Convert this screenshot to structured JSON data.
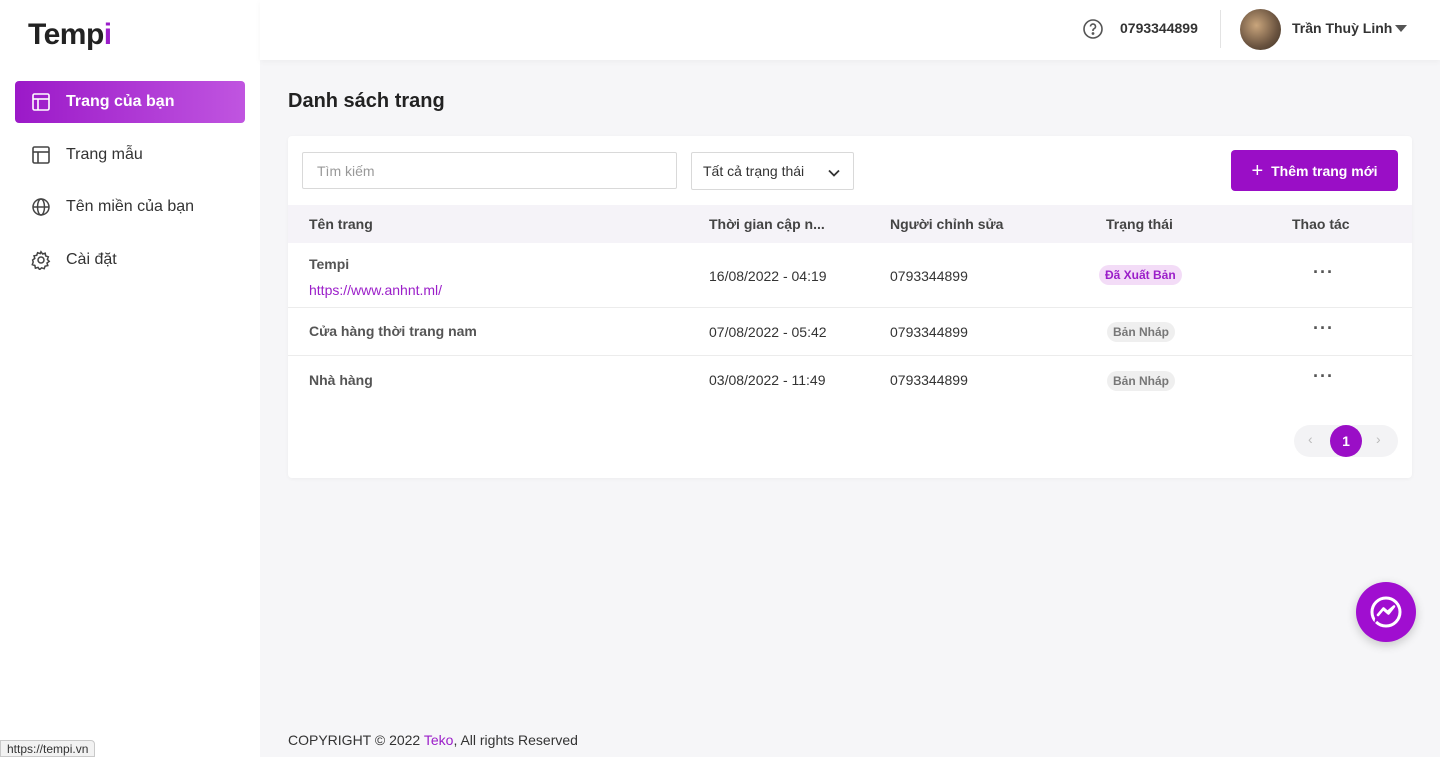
{
  "app": {
    "logo_main": "Temp",
    "logo_accent": "i"
  },
  "sidebar": {
    "items": [
      {
        "label": "Trang của bạn",
        "icon": "layout-icon",
        "active": true
      },
      {
        "label": "Trang mẫu",
        "icon": "layout-icon"
      },
      {
        "label": "Tên miền của bạn",
        "icon": "globe-icon"
      },
      {
        "label": "Cài đặt",
        "icon": "gear-icon"
      }
    ]
  },
  "header": {
    "phone": "0793344899",
    "user_name": "Trần Thuỳ Linh"
  },
  "main": {
    "title": "Danh sách trang",
    "search_placeholder": "Tìm kiếm",
    "status_filter": "Tất cả trạng thái",
    "add_button": "Thêm trang mới",
    "columns": [
      "Tên trang",
      "Thời gian cập n...",
      "Người chỉnh sửa",
      "Trạng thái",
      "Thao tác"
    ],
    "rows": [
      {
        "name": "Tempi",
        "url": "https://www.anhnt.ml/",
        "time": "16/08/2022 - 04:19",
        "editor": "0793344899",
        "status": "Đã Xuất Bản",
        "more": "···"
      },
      {
        "name": "Cửa hàng thời trang nam",
        "time": "07/08/2022 - 05:42",
        "editor": "0793344899",
        "status": "Bản Nháp",
        "more": "···"
      },
      {
        "name": "Nhà hàng",
        "time": "03/08/2022 - 11:49",
        "editor": "0793344899",
        "status": "Bản Nháp",
        "more": "···"
      }
    ],
    "pagination": {
      "prev": "‹",
      "current": "1",
      "next": "›"
    }
  },
  "footer": {
    "prefix": "COPYRIGHT © 2022 ",
    "brand": "Teko",
    "suffix": ", All rights Reserved"
  },
  "statusbar": {
    "url": "https://tempi.vn"
  },
  "colors": {
    "accent": "#9a0ec6",
    "published_bg": "#f3dcf7",
    "draft_bg": "#efefef"
  }
}
